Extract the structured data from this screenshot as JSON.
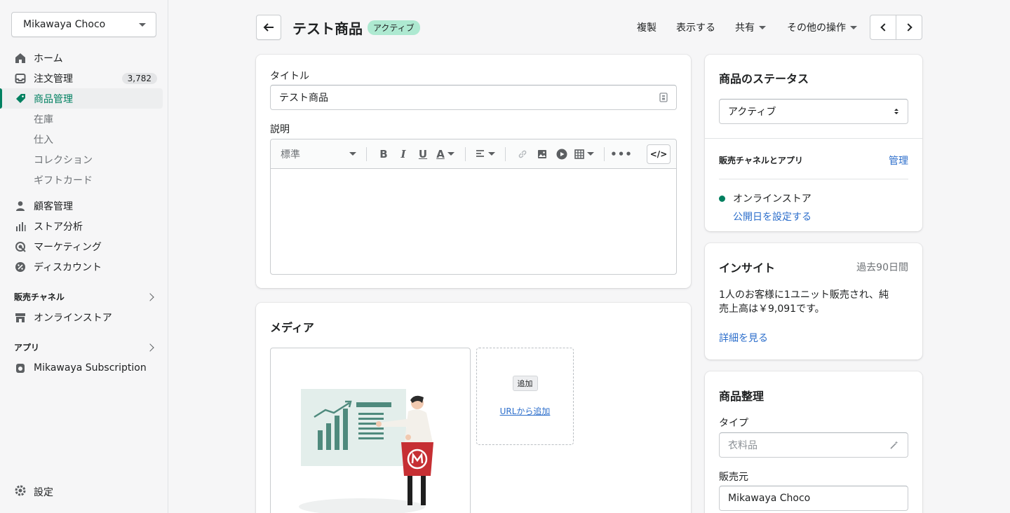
{
  "sidebar": {
    "store_name": "Mikawaya Choco",
    "items": [
      {
        "label": "ホーム",
        "icon": "home-icon"
      },
      {
        "label": "注文管理",
        "icon": "inbox-icon",
        "badge": "3,782"
      },
      {
        "label": "商品管理",
        "icon": "tag-icon",
        "active": true
      }
    ],
    "product_sub": [
      "在庫",
      "仕入",
      "コレクション",
      "ギフトカード"
    ],
    "items2": [
      {
        "label": "顧客管理",
        "icon": "person-icon"
      },
      {
        "label": "ストア分析",
        "icon": "bar-chart-icon"
      },
      {
        "label": "マーケティング",
        "icon": "target-icon"
      },
      {
        "label": "ディスカウント",
        "icon": "discount-icon"
      }
    ],
    "channels_title": "販売チャネル",
    "channel_item": "オンラインストア",
    "apps_title": "アプリ",
    "app_item": "Mikawaya Subscription",
    "settings": "設定"
  },
  "header": {
    "title": "テスト商品",
    "status": "アクティブ",
    "actions": [
      "複製",
      "表示する",
      "共有",
      "その他の操作"
    ]
  },
  "product": {
    "title_label": "タイトル",
    "title_value": "テスト商品",
    "description_label": "説明",
    "format_select": "標準"
  },
  "media": {
    "title": "メディア",
    "add_label": "追加",
    "add_url": "URLから追加"
  },
  "status_card": {
    "title": "商品のステータス",
    "select_value": "アクティブ",
    "channels_label": "販売チャネルとアプリ",
    "manage": "管理",
    "channel": "オンラインストア",
    "schedule": "公開日を設定する"
  },
  "insights": {
    "title": "インサイト",
    "period": "過去90日間",
    "text_line1": "1人のお客様に1ユニット販売され、純",
    "text_line2": "売上高は￥9,091です。",
    "details": "詳細を見る"
  },
  "organization": {
    "title": "商品整理",
    "type_label": "タイプ",
    "type_placeholder": "衣料品",
    "vendor_label": "販売元",
    "vendor_value": "Mikawaya Choco"
  },
  "colors": {
    "accent": "#008060",
    "link": "#2c6ecb",
    "badge": "#aee9d1"
  }
}
